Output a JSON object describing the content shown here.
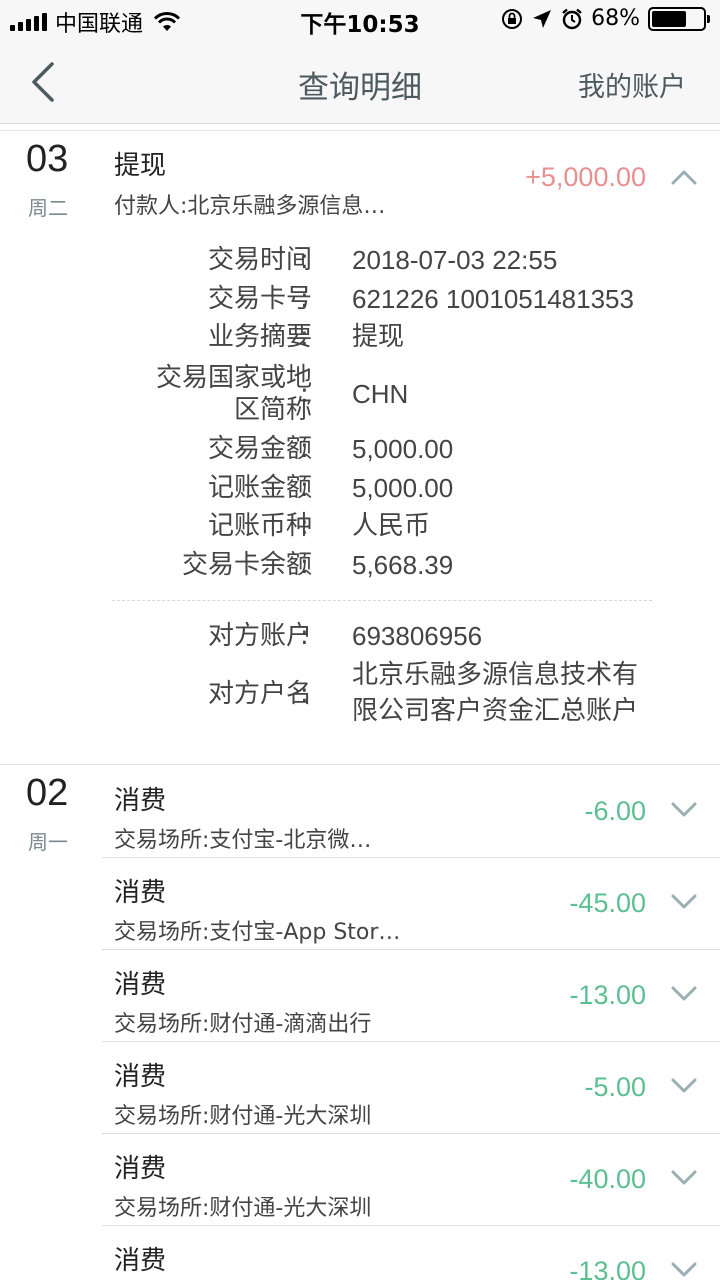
{
  "status_bar": {
    "carrier": "中国联通",
    "time": "下午10:53",
    "battery": "68%",
    "battery_level": 0.68
  },
  "nav": {
    "title": "查询明细",
    "right_action": "我的账户"
  },
  "groups": [
    {
      "day": "03",
      "weekday": "周二",
      "transactions": [
        {
          "type": "提现",
          "sub": "付款人:北京乐融多源信息…",
          "amount": "+5,000.00",
          "expanded": true,
          "details": [
            {
              "label": "交易时间",
              "value": "2018-07-03 22:55"
            },
            {
              "label": "交易卡号",
              "value": "621226 1001051481353"
            },
            {
              "label": "业务摘要",
              "value": "提现"
            },
            {
              "label": "交易国家或地区简称",
              "label_lines": [
                "交易国家或地",
                "区简称"
              ],
              "value": "CHN"
            },
            {
              "label": "交易金额",
              "value": "5,000.00"
            },
            {
              "label": "记账金额",
              "value": "5,000.00"
            },
            {
              "label": "记账币种",
              "value": "人民币"
            },
            {
              "label": "交易卡余额",
              "value": "5,668.39"
            }
          ],
          "counterparty": [
            {
              "label": "对方账户",
              "value": "693806956"
            },
            {
              "label": "对方户名",
              "value_lines": [
                "北京乐融多源信息技术有",
                "限公司客户资金汇总账户"
              ]
            }
          ]
        }
      ]
    },
    {
      "day": "02",
      "weekday": "周一",
      "transactions": [
        {
          "type": "消费",
          "sub": "交易场所:支付宝-北京微…",
          "amount": "-6.00"
        },
        {
          "type": "消费",
          "sub": "交易场所:支付宝-App Stor…",
          "amount": "-45.00"
        },
        {
          "type": "消费",
          "sub": "交易场所:财付通-滴滴出行",
          "amount": "-13.00"
        },
        {
          "type": "消费",
          "sub": "交易场所:财付通-光大深圳",
          "amount": "-5.00"
        },
        {
          "type": "消费",
          "sub": "交易场所:财付通-光大深圳",
          "amount": "-40.00"
        },
        {
          "type": "消费",
          "sub": "",
          "amount": "-13.00"
        }
      ]
    }
  ],
  "colors": {
    "positive": "#e88f8f",
    "negative": "#5cbf92",
    "nav_text": "#4d5b60"
  }
}
